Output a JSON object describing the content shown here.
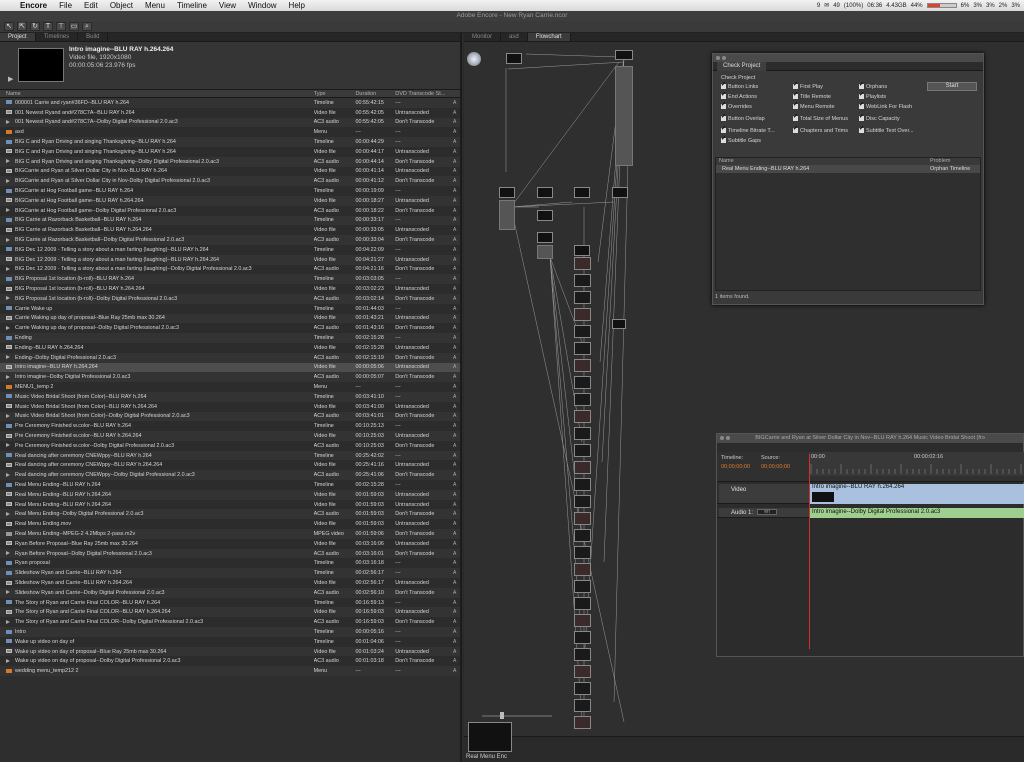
{
  "menubar": {
    "app": "Encore",
    "items": [
      "File",
      "Edit",
      "Object",
      "Menu",
      "Timeline",
      "View",
      "Window",
      "Help"
    ],
    "battery": "(100%)",
    "clock": "06:36",
    "mail_count": "49",
    "status_small": "9",
    "memory": "4.43GB",
    "cpu_pct": "44%",
    "disk_pcts": [
      "6%",
      "3%",
      "3%",
      "2%",
      "3%"
    ],
    "cpu_meter_fraction": 0.44
  },
  "window": {
    "title": "Adobe Encore - New Ryan Carrie.ncor"
  },
  "toolbar": {
    "tools": [
      "arrow",
      "direct-select",
      "rotate",
      "text",
      "vertical-text",
      "text-frame",
      "zoom"
    ]
  },
  "project": {
    "tabs": [
      "Project",
      "Timelines",
      "Build"
    ],
    "preview": {
      "title": "Intro imagine--BLU RAY h.264.264",
      "line2": "Video file, 1920x1080",
      "line3": "00:00:05:06  23.976 fps"
    },
    "columns": [
      "Name",
      "Type",
      "Duration",
      "DVD Transcode St...",
      ""
    ],
    "rows": [
      {
        "icon": "timeline",
        "name": "000001 Carrie and ryan#36FD--BLU RAY h.264",
        "type": "Timeline",
        "dur": "00:55:42:15",
        "dvd": "---",
        "extra": "A"
      },
      {
        "icon": "video",
        "name": "001 Newest Ryand and#278C7A--BLU RAY h.264",
        "type": "Video file",
        "dur": "00:55:42:05",
        "dvd": "Untranscoded",
        "extra": "A"
      },
      {
        "icon": "audio",
        "name": "001 Newest Ryand and#278C7A--Dolby Digital Professional 2.0.ac3",
        "type": "AC3 audio",
        "dur": "00:55:42:05",
        "dvd": "Don't Transcode",
        "extra": "A"
      },
      {
        "icon": "menu",
        "name": "asd",
        "type": "Menu",
        "dur": "---",
        "dvd": "---",
        "extra": "A"
      },
      {
        "icon": "timeline",
        "name": "BIG C and Ryan Driving and singing Thanksgiving--BLU RAY h.264",
        "type": "Timeline",
        "dur": "00:00:44:29",
        "dvd": "---",
        "extra": "A"
      },
      {
        "icon": "video",
        "name": "BIG C and Ryan Driving and singing Thanksgiving--BLU RAY h.264",
        "type": "Video file",
        "dur": "00:00:44:17",
        "dvd": "Untranscoded",
        "extra": "A"
      },
      {
        "icon": "audio",
        "name": "BIG C and Ryan Driving and singing Thanksgiving--Dolby Digital Professional 2.0.ac3",
        "type": "AC3 audio",
        "dur": "00:00:44:14",
        "dvd": "Don't Transcode",
        "extra": "A"
      },
      {
        "icon": "video",
        "name": "BIGCarrie and Ryan at Silver Dollar City in Nov-BLU RAY h.264",
        "type": "Video file",
        "dur": "00:00:41:14",
        "dvd": "Untranscoded",
        "extra": "A"
      },
      {
        "icon": "audio",
        "name": "BIGCarrie and Ryan at Silver Dollar City in Nov-Dolby Digital Professional 2.0.ac3",
        "type": "AC3 audio",
        "dur": "00:00:41:12",
        "dvd": "Don't Transcode",
        "extra": "A"
      },
      {
        "icon": "timeline",
        "name": "BIGCarrie at Hog Football game--BLU RAY h.264",
        "type": "Timeline",
        "dur": "00:00:19:09",
        "dvd": "---",
        "extra": "A"
      },
      {
        "icon": "video",
        "name": "BIGCarrie at Hog Football game--BLU RAY h.264.264",
        "type": "Video file",
        "dur": "00:00:18:27",
        "dvd": "Untranscoded",
        "extra": "A"
      },
      {
        "icon": "audio",
        "name": "BIGCarrie at Hog Football game--Dolby Digital Professional 2.0.ac3",
        "type": "AC3 audio",
        "dur": "00:00:18:22",
        "dvd": "Don't Transcode",
        "extra": "A"
      },
      {
        "icon": "timeline",
        "name": "BIG Carrie at Razorback Basketball--BLU RAY h.264",
        "type": "Timeline",
        "dur": "00:00:33:17",
        "dvd": "---",
        "extra": "A"
      },
      {
        "icon": "video",
        "name": "BIG Carrie at Razorback Basketball--BLU RAY h.264.264",
        "type": "Video file",
        "dur": "00:00:33:05",
        "dvd": "Untranscoded",
        "extra": "A"
      },
      {
        "icon": "audio",
        "name": "BIG Carrie at Razorback Basketball--Dolby Digital Professional 2.0.ac3",
        "type": "AC3 audio",
        "dur": "00:00:33:04",
        "dvd": "Don't Transcode",
        "extra": "A"
      },
      {
        "icon": "timeline",
        "name": "BIG Dec 12 2009 - Telling a story about a man farting (laughing)--BLU RAY h.264",
        "type": "Timeline",
        "dur": "00:04:22:09",
        "dvd": "---",
        "extra": "A"
      },
      {
        "icon": "video",
        "name": "BIG Dec 12 2009 - Telling a story about a man farting (laughing)--BLU RAY h.264.264",
        "type": "Video file",
        "dur": "00:04:21:27",
        "dvd": "Untranscoded",
        "extra": "A"
      },
      {
        "icon": "audio",
        "name": "BIG Dec 12 2009 - Telling a story about a man farting (laughing)--Dolby Digital Professional 2.0.ac3",
        "type": "AC3 audio",
        "dur": "00:04:21:16",
        "dvd": "Don't Transcode",
        "extra": "A"
      },
      {
        "icon": "timeline",
        "name": "BIG Proposal 1st location (b-roll)--BLU RAY h.264",
        "type": "Timeline",
        "dur": "00:03:03:05",
        "dvd": "---",
        "extra": "A"
      },
      {
        "icon": "video",
        "name": "BIG Proposal 1st location (b-roll)--BLU RAY h.264.264",
        "type": "Video file",
        "dur": "00:03:02:23",
        "dvd": "Untranscoded",
        "extra": "A"
      },
      {
        "icon": "audio",
        "name": "BIG Proposal 1st location (b-roll)--Dolby Digital Professional 2.0.ac3",
        "type": "AC3 audio",
        "dur": "00:03:02:14",
        "dvd": "Don't Transcode",
        "extra": "A"
      },
      {
        "icon": "timeline",
        "name": "Carrie Wake up",
        "type": "Timeline",
        "dur": "00:01:44:03",
        "dvd": "---",
        "extra": "A"
      },
      {
        "icon": "video",
        "name": "Carrie Waking up day of proposal--Blue Ray 25mb max 30.264",
        "type": "Video file",
        "dur": "00:01:43:21",
        "dvd": "Untranscoded",
        "extra": "A"
      },
      {
        "icon": "audio",
        "name": "Carrie Waking up day of proposal--Dolby Digital Professional 2.0.ac3",
        "type": "AC3 audio",
        "dur": "00:01:43:16",
        "dvd": "Don't Transcode",
        "extra": "A"
      },
      {
        "icon": "timeline",
        "name": "Ending",
        "type": "Timeline",
        "dur": "00:02:15:28",
        "dvd": "---",
        "extra": "A"
      },
      {
        "icon": "video",
        "name": "Ending--BLU RAY h.264.264",
        "type": "Video file",
        "dur": "00:02:15:28",
        "dvd": "Untranscoded",
        "extra": "A"
      },
      {
        "icon": "audio",
        "name": "Ending--Dolby Digital Professional 2.0.ac3",
        "type": "AC3 audio",
        "dur": "00:02:15:19",
        "dvd": "Don't Transcode",
        "extra": "A"
      },
      {
        "icon": "video",
        "name": "Intro imagine--BLU RAY h.264.264",
        "type": "Video file",
        "dur": "00:00:05:06",
        "dvd": "Untranscoded",
        "extra": "A",
        "selected": true
      },
      {
        "icon": "audio",
        "name": "Intro imagine--Dolby Digital Professional 2.0.ac3",
        "type": "AC3 audio",
        "dur": "00:00:05:07",
        "dvd": "Don't Transcode",
        "extra": "A"
      },
      {
        "icon": "menu",
        "name": "MENU1_temp 2",
        "type": "Menu",
        "dur": "---",
        "dvd": "---",
        "extra": "A"
      },
      {
        "icon": "timeline",
        "name": "Music Video Bridal Shoot (from Color)--BLU RAY h.264",
        "type": "Timeline",
        "dur": "00:03:41:10",
        "dvd": "---",
        "extra": "A"
      },
      {
        "icon": "video",
        "name": "Music Video Bridal Shoot (from Color)--BLU RAY h.264.264",
        "type": "Video file",
        "dur": "00:03:41:00",
        "dvd": "Untranscoded",
        "extra": "A"
      },
      {
        "icon": "audio",
        "name": "Music Video Bridal Shoot (from Color)--Dolby Digital Professional 2.0.ac3",
        "type": "AC3 audio",
        "dur": "00:03:41:01",
        "dvd": "Don't Transcode",
        "extra": "A"
      },
      {
        "icon": "timeline",
        "name": "Pre Ceremony Finished w.color--BLU RAY h.264",
        "type": "Timeline",
        "dur": "00:10:25:13",
        "dvd": "---",
        "extra": "A"
      },
      {
        "icon": "video",
        "name": "Pre Ceremony Finished w.color--BLU RAY h.264.264",
        "type": "Video file",
        "dur": "00:10:25:03",
        "dvd": "Untranscoded",
        "extra": "A"
      },
      {
        "icon": "audio",
        "name": "Pre Ceremony Finished w.color--Dolby Digital Professional 2.0.ac3",
        "type": "AC3 audio",
        "dur": "00:10:25:03",
        "dvd": "Don't Transcode",
        "extra": "A"
      },
      {
        "icon": "timeline",
        "name": "Real dancing after ceremony CNEWppy--BLU RAY h.264",
        "type": "Timeline",
        "dur": "00:25:42:02",
        "dvd": "---",
        "extra": "A"
      },
      {
        "icon": "video",
        "name": "Real dancing after ceremony CNEWppy--BLU RAY h.264.264",
        "type": "Video file",
        "dur": "00:25:41:16",
        "dvd": "Untranscoded",
        "extra": "A"
      },
      {
        "icon": "audio",
        "name": "Real dancing after ceremony CNEWppy--Dolby Digital Professional 2.0.ac3",
        "type": "AC3 audio",
        "dur": "00:25:41:06",
        "dvd": "Don't Transcode",
        "extra": "A"
      },
      {
        "icon": "timeline",
        "name": "Real Menu Ending--BLU RAY h.264",
        "type": "Timeline",
        "dur": "00:02:15:28",
        "dvd": "---",
        "extra": "A"
      },
      {
        "icon": "video",
        "name": "Real Menu Ending--BLU RAY h.264.264",
        "type": "Video file",
        "dur": "00:01:59:03",
        "dvd": "Untranscoded",
        "extra": "A"
      },
      {
        "icon": "video",
        "name": "Real Menu Ending--BLU RAY h.264.264",
        "type": "Video file",
        "dur": "00:01:59:03",
        "dvd": "Untranscoded",
        "extra": "A"
      },
      {
        "icon": "audio",
        "name": "Real Menu Ending--Dolby Digital Professional 2.0.ac3",
        "type": "AC3 audio",
        "dur": "00:01:59:03",
        "dvd": "Don't Transcode",
        "extra": "A"
      },
      {
        "icon": "video",
        "name": "Real Menu Ending.mov",
        "type": "Video file",
        "dur": "00:01:59:03",
        "dvd": "Untranscoded",
        "extra": "A"
      },
      {
        "icon": "mpeg",
        "name": "Real Menu Ending--MPEG-2 4.2Mbps 2-pass.m2v",
        "type": "MPEG video",
        "dur": "00:01:59:06",
        "dvd": "Don't Transcode",
        "extra": "A"
      },
      {
        "icon": "video",
        "name": "Ryan Before Proposal--Blue Ray 25mb max 30.264",
        "type": "Video file",
        "dur": "00:03:16:06",
        "dvd": "Untranscoded",
        "extra": "A"
      },
      {
        "icon": "audio",
        "name": "Ryan Before Proposal--Dolby Digital Professional 2.0.ac3",
        "type": "AC3 audio",
        "dur": "00:03:16:01",
        "dvd": "Don't Transcode",
        "extra": "A"
      },
      {
        "icon": "timeline",
        "name": "Ryan proposal",
        "type": "Timeline",
        "dur": "00:03:16:18",
        "dvd": "---",
        "extra": "A"
      },
      {
        "icon": "timeline",
        "name": "Slideshow Ryan and Carrie--BLU RAY h.264",
        "type": "Timeline",
        "dur": "00:02:56:17",
        "dvd": "---",
        "extra": "A"
      },
      {
        "icon": "video",
        "name": "Slideshow Ryan and Carrie--BLU RAY h.264.264",
        "type": "Video file",
        "dur": "00:02:56:17",
        "dvd": "Untranscoded",
        "extra": "A"
      },
      {
        "icon": "audio",
        "name": "Slideshow Ryan and Carrie--Dolby Digital Professional 2.0.ac3",
        "type": "AC3 audio",
        "dur": "00:02:56:10",
        "dvd": "Don't Transcode",
        "extra": "A"
      },
      {
        "icon": "timeline",
        "name": "The Story of Ryan and Carrie Final COLOR--BLU RAY h.264",
        "type": "Timeline",
        "dur": "00:16:59:13",
        "dvd": "---",
        "extra": "A"
      },
      {
        "icon": "video",
        "name": "The Story of Ryan and Carrie Final COLOR--BLU RAY h.264.264",
        "type": "Video file",
        "dur": "00:16:59:03",
        "dvd": "Untranscoded",
        "extra": "A"
      },
      {
        "icon": "audio",
        "name": "The Story of Ryan and Carrie Final COLOR--Dolby Digital Professional 2.0.ac3",
        "type": "AC3 audio",
        "dur": "00:16:59:03",
        "dvd": "Don't Transcode",
        "extra": "A"
      },
      {
        "icon": "timeline",
        "name": "Intro",
        "type": "Timeline",
        "dur": "00:00:05:16",
        "dvd": "---",
        "extra": "A"
      },
      {
        "icon": "timeline",
        "name": "Wake up video on day of",
        "type": "Timeline",
        "dur": "00:01:04:06",
        "dvd": "---",
        "extra": "A"
      },
      {
        "icon": "video",
        "name": "Wake up video on day of proposal--Blue Ray 25mb max 30.264",
        "type": "Video file",
        "dur": "00:01:03:24",
        "dvd": "Untranscoded",
        "extra": "A"
      },
      {
        "icon": "audio",
        "name": "Wake up video on day of proposal--Dolby Digital Professional 2.0.ac3",
        "type": "AC3 audio",
        "dur": "00:01:03:18",
        "dvd": "Don't Transcode",
        "extra": "A"
      },
      {
        "icon": "menu",
        "name": "wedding menu_temp212 2",
        "type": "Menu",
        "dur": "---",
        "dvd": "---",
        "extra": "A"
      }
    ]
  },
  "right": {
    "tabs": [
      "Monitor",
      "asd",
      "Flowchart"
    ],
    "menu_thumb_label": "Real Menu Enc"
  },
  "check_project": {
    "tab": "Check Project",
    "section": "Check Project",
    "options": [
      {
        "label": "Button Links",
        "checked": true
      },
      {
        "label": "First Play",
        "checked": true
      },
      {
        "label": "Orphans",
        "checked": true
      },
      {
        "label": "End Actions",
        "checked": true
      },
      {
        "label": "Title Remote",
        "checked": true
      },
      {
        "label": "Playlists",
        "checked": true
      },
      {
        "label": "Overrides",
        "checked": true
      },
      {
        "label": "Menu Remote",
        "checked": true
      },
      {
        "label": "WebLink For Flash",
        "checked": true
      },
      {
        "label": "Button Overlap",
        "checked": true
      },
      {
        "label": "Total Size of Menus",
        "checked": true
      },
      {
        "label": "Disc Capacity",
        "checked": true
      },
      {
        "label": "Timeline Bitrate T...",
        "checked": true
      },
      {
        "label": "Chapters and Trims",
        "checked": true
      },
      {
        "label": "Subtitle Text Over...",
        "checked": true
      },
      {
        "label": "Subtitle Gaps",
        "checked": true
      }
    ],
    "start_label": "Start",
    "list_cols": [
      "Name",
      "Problem"
    ],
    "result": {
      "name": "Real Menu Ending--BLU RAY h.264",
      "problem": "Orphan Timeline"
    },
    "footer": "1 items found."
  },
  "timeline": {
    "title": "BIGCarrie and Ryan at Silver Dollar City in Nov--BLU RAY h.264   Music Video Bridal Shoot (fro",
    "timeline_label": "Timeline:",
    "source_label": "Source:",
    "timeline_tc": "00;00;00;00",
    "source_tc": "00;00;00;00",
    "ruler_start": "00:00",
    "ruler_mid": "00:00:02:16",
    "video_track": "Video",
    "video_clip": "Intro imagine--BLU RAY h.264.264",
    "audio_track": "Audio 1:",
    "audio_sel": "en",
    "audio_clip": "Intro imagine--Dolby Digital Professional 2.0.ac3"
  }
}
